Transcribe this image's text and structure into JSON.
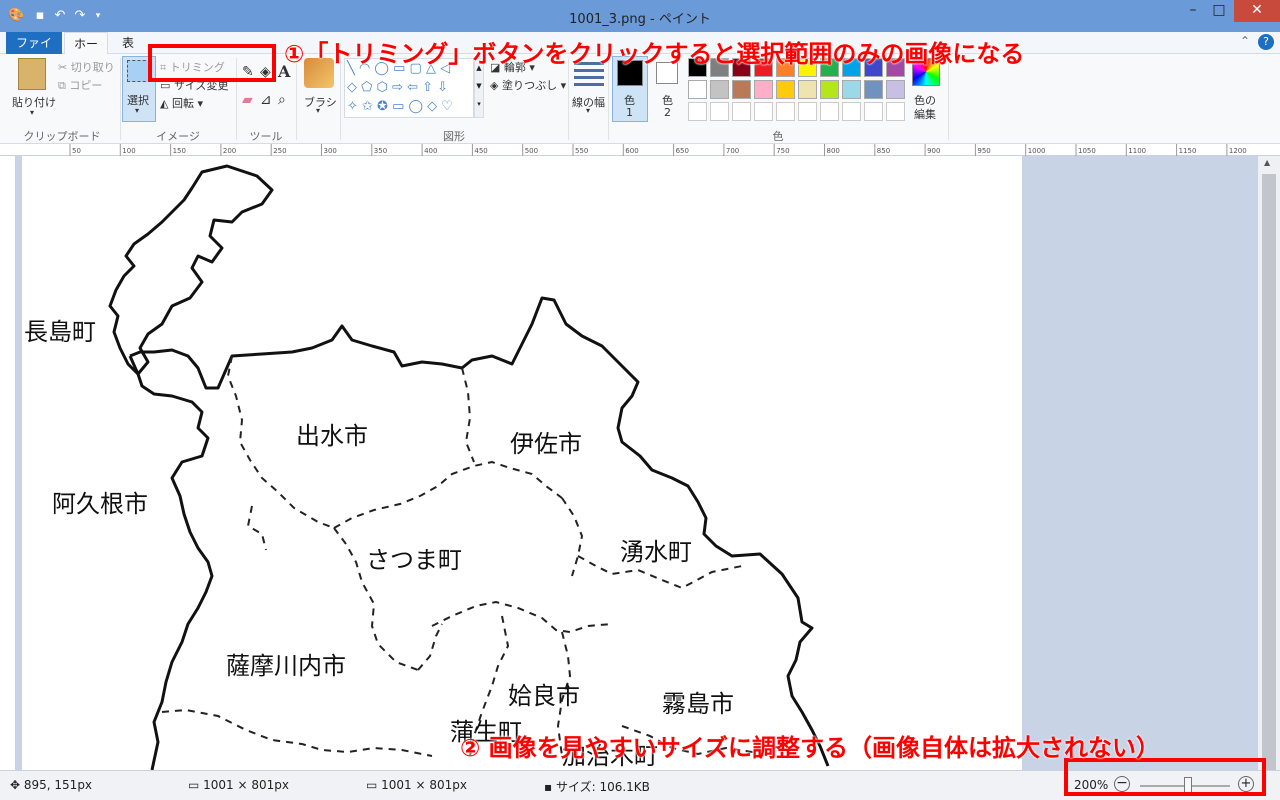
{
  "window": {
    "title": "1001_3.png - ペイント",
    "minimize": "–",
    "maximize": "□",
    "close": "✕"
  },
  "tabs": {
    "file": "ファイル",
    "home": "ホーム",
    "view": "表示"
  },
  "ribbon": {
    "clipboard": {
      "paste": "貼り付け",
      "cut": "切り取り",
      "copy": "コピー",
      "group": "クリップボード"
    },
    "image": {
      "select": "選択",
      "crop": "トリミング",
      "resize": "サイズ変更",
      "rotate": "回転",
      "group": "イメージ"
    },
    "tools": {
      "group": "ツール"
    },
    "brush": {
      "label": "ブラシ"
    },
    "shapes": {
      "outline": "輪郭",
      "fill": "塗りつぶし",
      "group": "図形"
    },
    "size": {
      "label": "線の幅"
    },
    "colors": {
      "color1": "色",
      "color1_num": "1",
      "color2": "色",
      "color2_num": "2",
      "edit": "色の編集",
      "edit1": "色の",
      "edit2": "編集",
      "group": "色",
      "palette_row1": [
        "#000000",
        "#7f7f7f",
        "#880015",
        "#ed1c24",
        "#ff7f27",
        "#fff200",
        "#22b14c",
        "#00a2e8",
        "#3f48cc",
        "#a349a4"
      ],
      "palette_row2": [
        "#ffffff",
        "#c3c3c3",
        "#b97a57",
        "#ffaec9",
        "#ffc90e",
        "#efe4b0",
        "#b5e61d",
        "#99d9ea",
        "#7092be",
        "#c8bfe7"
      ]
    }
  },
  "ruler_labels": [
    "50",
    "100",
    "150",
    "200",
    "250",
    "300",
    "350",
    "400",
    "450",
    "500",
    "550",
    "600",
    "650",
    "700",
    "750",
    "800",
    "850",
    "900",
    "950",
    "1000",
    "1050",
    "1100",
    "1150",
    "1200"
  ],
  "map_labels": {
    "nagashima": "長島町",
    "akune": "阿久根市",
    "izumi": "出水市",
    "isa": "伊佐市",
    "satsuma": "さつま町",
    "yusui": "湧水町",
    "satsumasendai": "薩摩川内市",
    "aira": "姶良市",
    "kirishima": "霧島市",
    "kamou": "蒲生町",
    "kajiki": "加治木町"
  },
  "annotations": {
    "step1": "①「トリミング」ボタンをクリックすると選択範囲のみの画像になる",
    "step2": "② 画像を見やすいサイズに調整する（画像自体は拡大されない）"
  },
  "status": {
    "cursor": "895, 151px",
    "selection": "1001 × 801px",
    "image_size": "1001 × 801px",
    "file_size": "サイズ: 106.1KB",
    "zoom": "200%"
  }
}
